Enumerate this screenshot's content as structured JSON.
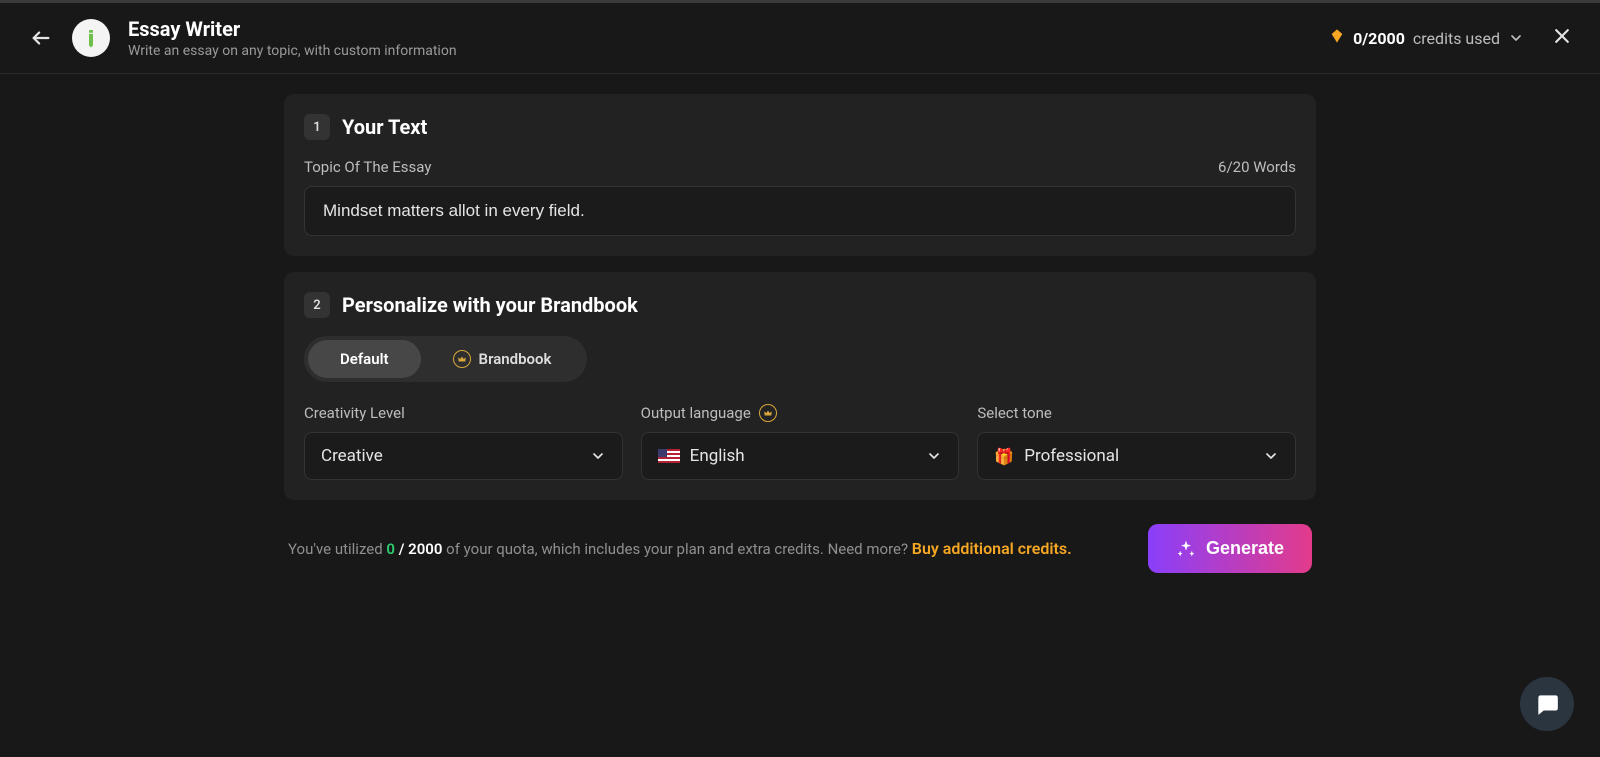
{
  "header": {
    "title": "Essay Writer",
    "subtitle": "Write an essay on any topic, with custom information",
    "credits_used": "0/2000",
    "credits_label": "credits used"
  },
  "section1": {
    "step": "1",
    "title": "Your Text",
    "field_label": "Topic Of The Essay",
    "word_count": "6/20 Words",
    "value": "Mindset matters allot in every field."
  },
  "section2": {
    "step": "2",
    "title": "Personalize with your Brandbook",
    "pill_default": "Default",
    "pill_brandbook": "Brandbook",
    "creativity_label": "Creativity Level",
    "creativity_value": "Creative",
    "language_label": "Output language",
    "language_value": "English",
    "tone_label": "Select tone",
    "tone_value": "Professional"
  },
  "footer": {
    "quota_prefix": "You've utilized ",
    "quota_used": "0",
    "quota_sep": " / ",
    "quota_total": "2000",
    "quota_suffix": " of your quota, which includes your plan and extra credits. Need more? ",
    "buy_link": "Buy additional credits.",
    "generate": "Generate"
  }
}
